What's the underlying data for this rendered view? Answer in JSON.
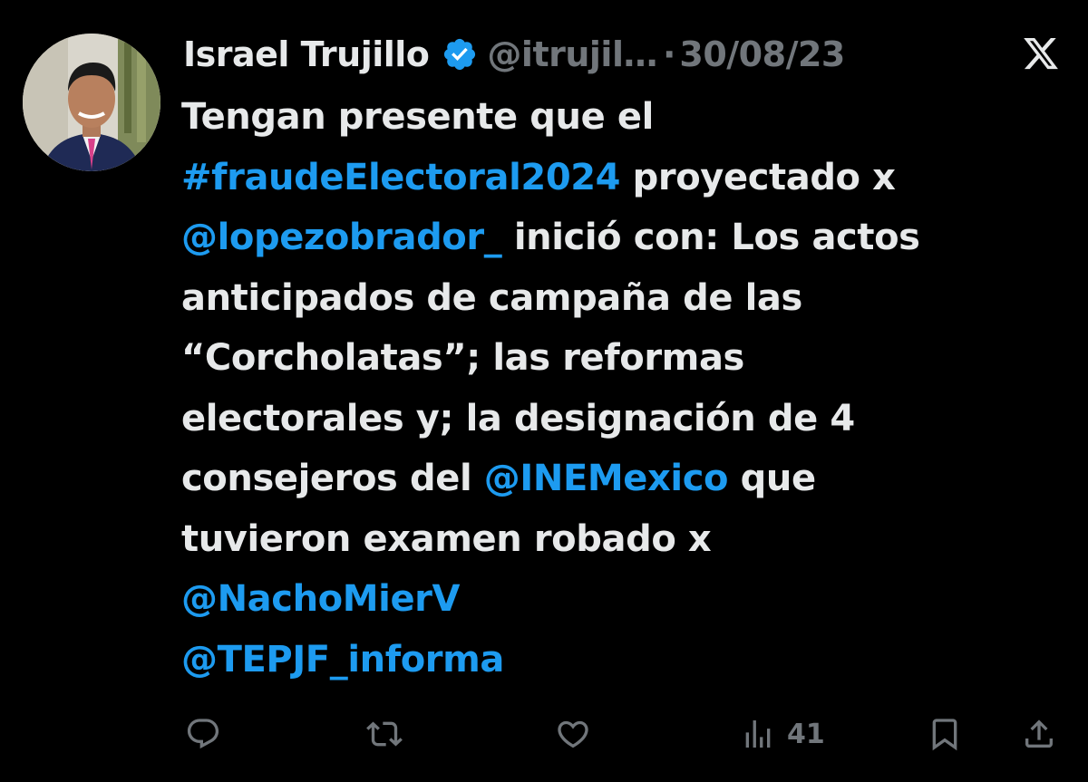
{
  "author": {
    "name": "Israel Trujillo",
    "handle": "@itrujil…",
    "separator": "·",
    "date": "30/08/23"
  },
  "tweet_lines": [
    [
      {
        "text": "Tengan presente que el",
        "link": false
      }
    ],
    [
      {
        "text": "#fraudeElectoral2024",
        "link": true
      },
      {
        "text": " proyectado x",
        "link": false
      }
    ],
    [
      {
        "text": "@lopezobrador_",
        "link": true
      },
      {
        "text": " inició con: Los actos",
        "link": false
      }
    ],
    [
      {
        "text": "anticipados de campaña de las",
        "link": false
      }
    ],
    [
      {
        "text": "“Corcholatas”; las reformas",
        "link": false
      }
    ],
    [
      {
        "text": "electorales y; la designación de 4",
        "link": false
      }
    ],
    [
      {
        "text": "consejeros del ",
        "link": false
      },
      {
        "text": "@INEMexico",
        "link": true
      },
      {
        "text": " que",
        "link": false
      }
    ],
    [
      {
        "text": "tuvieron examen robado x",
        "link": false
      }
    ],
    [
      {
        "text": "@NachoMierV",
        "link": true
      }
    ],
    [
      {
        "text": "@TEPJF_informa",
        "link": true
      }
    ]
  ],
  "actions": {
    "views_count": "41"
  },
  "colors": {
    "background": "#000000",
    "text": "#e7e9ea",
    "muted": "#71767b",
    "link": "#1d9bf0",
    "verified": "#1d9bf0"
  },
  "icons": [
    "verified-badge-icon",
    "x-logo-icon",
    "reply-icon",
    "retweet-icon",
    "like-icon",
    "views-icon",
    "bookmark-icon",
    "share-icon"
  ]
}
